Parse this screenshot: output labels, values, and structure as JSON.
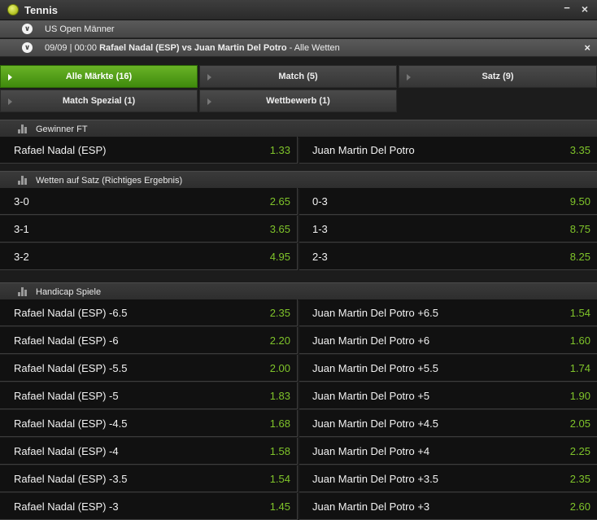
{
  "header": {
    "title": "Tennis",
    "minimize": "−",
    "close": "×"
  },
  "breadcrumb": {
    "competition": "US Open Männer",
    "event_prefix": "09/09 | 00:00 ",
    "event_match": "Rafael Nadal (ESP) vs Juan Martin Del Potro",
    "event_suffix": " - Alle Wetten",
    "close": "×"
  },
  "tabs": [
    {
      "label": "Alle Märkte (16)",
      "active": true
    },
    {
      "label": "Match (5)",
      "active": false
    },
    {
      "label": "Satz (9)",
      "active": false
    },
    {
      "label": "Match Spezial (1)",
      "active": false
    },
    {
      "label": "Wettbewerb (1)",
      "active": false
    }
  ],
  "sections": {
    "winner": {
      "title": "Gewinner FT",
      "rows": [
        {
          "left": {
            "name": "Rafael Nadal (ESP)",
            "odds": "1.33"
          },
          "right": {
            "name": "Juan Martin Del Potro",
            "odds": "3.35"
          }
        }
      ]
    },
    "sets": {
      "title": "Wetten auf Satz (Richtiges Ergebnis)",
      "rows": [
        {
          "left": {
            "name": "3-0",
            "odds": "2.65"
          },
          "right": {
            "name": "0-3",
            "odds": "9.50"
          }
        },
        {
          "left": {
            "name": "3-1",
            "odds": "3.65"
          },
          "right": {
            "name": "1-3",
            "odds": "8.75"
          }
        },
        {
          "left": {
            "name": "3-2",
            "odds": "4.95"
          },
          "right": {
            "name": "2-3",
            "odds": "8.25"
          }
        }
      ]
    },
    "handicap": {
      "title": "Handicap Spiele",
      "rows": [
        {
          "left": {
            "name": "Rafael Nadal (ESP) -6.5",
            "odds": "2.35"
          },
          "right": {
            "name": "Juan Martin Del Potro +6.5",
            "odds": "1.54"
          }
        },
        {
          "left": {
            "name": "Rafael Nadal (ESP) -6",
            "odds": "2.20"
          },
          "right": {
            "name": "Juan Martin Del Potro +6",
            "odds": "1.60"
          }
        },
        {
          "left": {
            "name": "Rafael Nadal (ESP) -5.5",
            "odds": "2.00"
          },
          "right": {
            "name": "Juan Martin Del Potro +5.5",
            "odds": "1.74"
          }
        },
        {
          "left": {
            "name": "Rafael Nadal (ESP) -5",
            "odds": "1.83"
          },
          "right": {
            "name": "Juan Martin Del Potro +5",
            "odds": "1.90"
          }
        },
        {
          "left": {
            "name": "Rafael Nadal (ESP) -4.5",
            "odds": "1.68"
          },
          "right": {
            "name": "Juan Martin Del Potro +4.5",
            "odds": "2.05"
          }
        },
        {
          "left": {
            "name": "Rafael Nadal (ESP) -4",
            "odds": "1.58"
          },
          "right": {
            "name": "Juan Martin Del Potro +4",
            "odds": "2.25"
          }
        },
        {
          "left": {
            "name": "Rafael Nadal (ESP) -3.5",
            "odds": "1.54"
          },
          "right": {
            "name": "Juan Martin Del Potro +3.5",
            "odds": "2.35"
          }
        },
        {
          "left": {
            "name": "Rafael Nadal (ESP) -3",
            "odds": "1.45"
          },
          "right": {
            "name": "Juan Martin Del Potro +3",
            "odds": "2.60"
          }
        }
      ]
    }
  },
  "colors": {
    "accent": "#69b326",
    "odds": "#7fc42a",
    "background": "#1c1c1c"
  },
  "icons": {
    "sport": "tennis-ball-icon",
    "section": "bar-chart-icon",
    "expand": "chevron-down-icon"
  }
}
